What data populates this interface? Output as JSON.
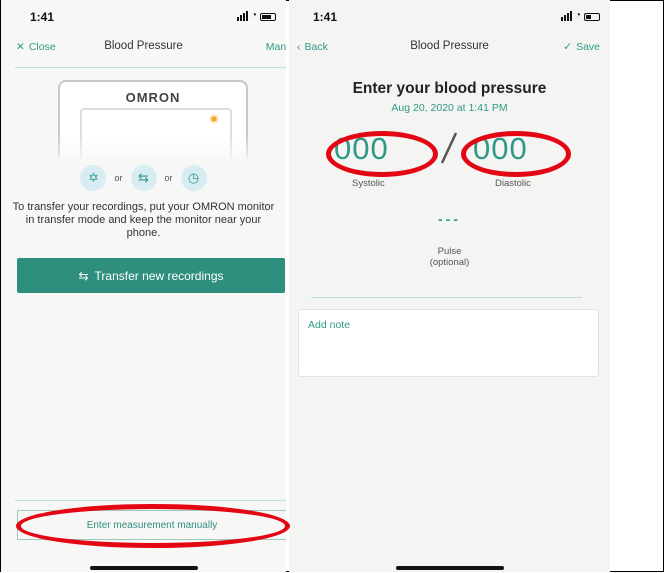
{
  "left": {
    "status_time": "1:41",
    "nav": {
      "close": "Close",
      "title": "Blood Pressure",
      "manage": "Mana"
    },
    "device_brand": "OMRON",
    "or_1": "or",
    "or_2": "or",
    "instructions": "To transfer your recordings, put your OMRON monitor in transfer mode and keep the monitor near your phone.",
    "transfer_button": "Transfer new recordings",
    "manual_button": "Enter measurement manually"
  },
  "right": {
    "status_time": "1:41",
    "nav": {
      "back": "Back",
      "title": "Blood Pressure",
      "save": "Save"
    },
    "heading": "Enter your blood pressure",
    "datetime": "Aug 20, 2020 at 1:41 PM",
    "systolic_value": "000",
    "diastolic_value": "000",
    "systolic_label": "Systolic",
    "diastolic_label": "Diastolic",
    "pulse_value": "---",
    "pulse_label": "Pulse",
    "pulse_optional": "(optional)",
    "note_label": "Add note"
  },
  "colors": {
    "accent": "#2e9a86",
    "button": "#2e8f7f",
    "highlight": "#e30613"
  }
}
